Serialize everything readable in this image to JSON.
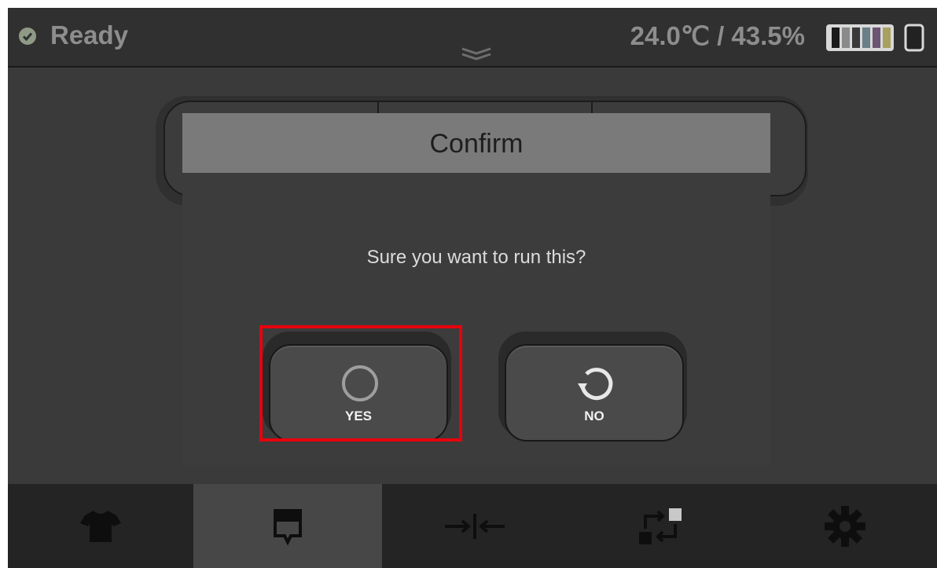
{
  "status": {
    "label": "Ready",
    "environment": "24.0℃ / 43.5%"
  },
  "dialog": {
    "title": "Confirm",
    "message": "Sure you want to run this?",
    "yes_label": "YES",
    "no_label": "NO"
  },
  "bottom_tabs": [
    {
      "icon": "shirt-icon",
      "active": false
    },
    {
      "icon": "ink-drop-icon",
      "active": true
    },
    {
      "icon": "alignment-icon",
      "active": false
    },
    {
      "icon": "transfer-icon",
      "active": false
    },
    {
      "icon": "gear-icon",
      "active": false
    }
  ],
  "colors": {
    "highlight": "#e8000d",
    "status_ok": "#8f9a86"
  }
}
